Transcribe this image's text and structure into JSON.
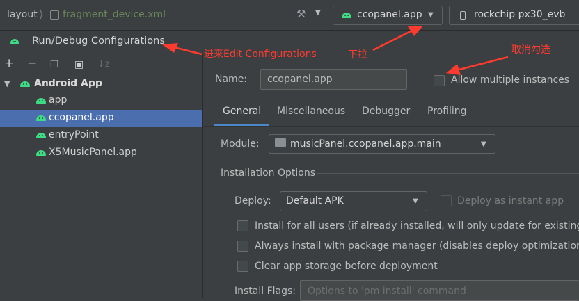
{
  "breadcrumb": {
    "layout": "layout",
    "file": "fragment_device.xml"
  },
  "toolbar": {
    "run_config": "ccopanel.app",
    "device": "rockchip px30_evb"
  },
  "dialog": {
    "title": "Run/Debug Configurations"
  },
  "tree": {
    "root": "Android App",
    "items": [
      {
        "label": "app",
        "selected": false
      },
      {
        "label": "ccopanel.app",
        "selected": true
      },
      {
        "label": "entryPoint",
        "selected": false
      },
      {
        "label": "X5MusicPanel.app",
        "selected": false
      }
    ]
  },
  "config": {
    "name_label": "Name:",
    "name_value": "ccopanel.app",
    "allow_multiple": "Allow multiple instances",
    "tabs": [
      "General",
      "Miscellaneous",
      "Debugger",
      "Profiling"
    ],
    "module_label": "Module:",
    "module_value": "musicPanel.ccopanel.app.main",
    "install_header": "Installation Options",
    "deploy_label": "Deploy:",
    "deploy_value": "Default APK",
    "deploy_instant": "Deploy as instant app",
    "install_all_users": "Install for all users (if already installed, will only update for existing us",
    "always_install": "Always install with package manager (disables deploy optimizations o",
    "clear_storage": "Clear app storage before deployment",
    "install_flags_label": "Install Flags:",
    "install_flags_placeholder": "Options to 'pm install' command"
  },
  "annotations": {
    "edit_config": "进来Edit Configurations",
    "dropdown": "下拉",
    "uncheck": "取消勾选",
    "color": "#ff3b30"
  },
  "colors": {
    "selection": "#4b6eaf",
    "tab_accent": "#4a88c7",
    "android_green": "#3ddc84"
  }
}
